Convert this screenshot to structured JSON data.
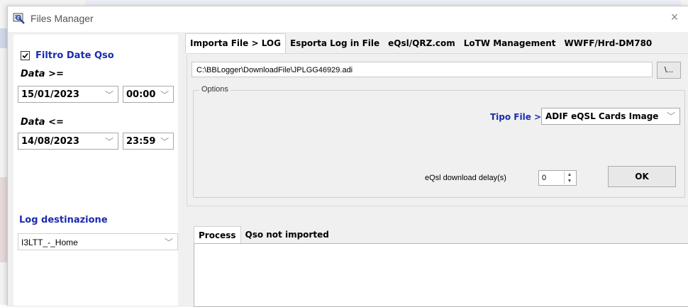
{
  "window": {
    "title": "Files Manager",
    "close_label": "×"
  },
  "icons": {
    "app": "files-manager-icon",
    "close": "close-icon",
    "dropdown": "chevron-down-icon",
    "check": "check-icon"
  },
  "left_panel": {
    "filter_checked": true,
    "filter_label": "Filtro Date Qso",
    "date_from_label": "Data >=",
    "date_from_value": "15/01/2023",
    "time_from_value": "00:00",
    "date_to_label": "Data <=",
    "date_to_value": "14/08/2023",
    "time_to_value": "23:59",
    "log_dest_label": "Log destinazione",
    "log_dest_value": "I3LTT_-_Home"
  },
  "tabs": [
    {
      "label": "Importa File > LOG",
      "active": true
    },
    {
      "label": "Esporta Log in File",
      "active": false
    },
    {
      "label": "eQsl/QRZ.com",
      "active": false
    },
    {
      "label": "LoTW Management",
      "active": false
    },
    {
      "label": "WWFF/Hrd-DM780",
      "active": false
    }
  ],
  "import": {
    "file_path": "C:\\BBLogger\\DownloadFile\\JPLGG46929.adi",
    "browse_label": "\\...",
    "options_label": "Options",
    "tipo_file_label": "Tipo File >",
    "tipo_file_value": "ADIF eQSL Cards Image",
    "delay_label": "eQsl download delay(s)",
    "delay_value": "0",
    "ok_label": "OK"
  },
  "lower_tabs": [
    {
      "label": "Process",
      "active": true
    },
    {
      "label": "Qso not imported",
      "active": false
    }
  ],
  "colors": {
    "accent_blue": "#1a2bb0",
    "window_bg": "#f0f0f0"
  }
}
